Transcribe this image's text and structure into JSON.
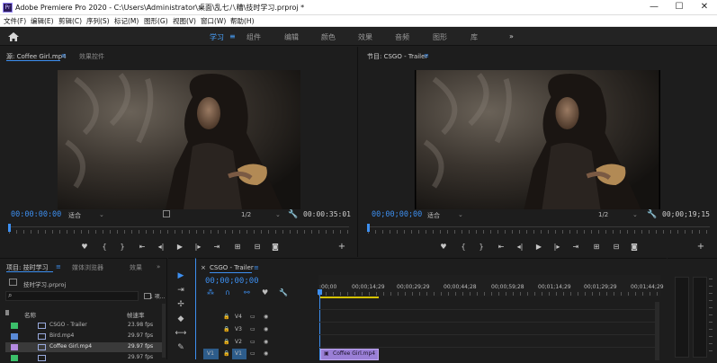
{
  "window": {
    "title": "Adobe Premiere Pro 2020 - C:\\Users\\Administrator\\桌面\\乱七八糟\\技时学习.prproj *",
    "minimize": "—",
    "maximize": "☐",
    "close": "✕"
  },
  "menu": [
    "文件(F)",
    "编辑(E)",
    "剪辑(C)",
    "序列(S)",
    "标记(M)",
    "图形(G)",
    "视图(V)",
    "窗口(W)",
    "帮助(H)"
  ],
  "workspaces": {
    "items": [
      "学习",
      "组件",
      "编辑",
      "颜色",
      "效果",
      "音频",
      "图形",
      "库"
    ],
    "active_menu": "≡",
    "more": "»"
  },
  "source_monitor": {
    "tabs": [
      "源: Coffee Girl.mp4",
      "效果控件"
    ],
    "menu_icon": "≡",
    "timecode_in": "00:00:00:00",
    "fit": "适合",
    "resolution": "1/2",
    "duration": "00:00:35:01"
  },
  "program_monitor": {
    "tab": "节目: CSGO - Trailer",
    "menu_icon": "≡",
    "timecode_in": "00;00;00;00",
    "fit": "适合",
    "resolution": "1/2",
    "duration": "00;00;19;15"
  },
  "transport": {
    "marker": "♥",
    "in": "{",
    "out": "}",
    "go_in": "⇤",
    "step_back": "◂|",
    "play": "▶",
    "step_fwd": "|▸",
    "go_out": "⇥",
    "insert": "⊞",
    "overwrite": "⊟",
    "export": "◙",
    "add": "+"
  },
  "project": {
    "tabs": [
      "项目: 技时学习",
      "媒体浏览器",
      "效果"
    ],
    "more": "»",
    "menu_icon": "≡",
    "filename": "技时学习.prproj",
    "search_icon": "⌕",
    "item_count": "1 项...",
    "columns": {
      "name": "名称",
      "fps": "帧速率"
    },
    "items": [
      {
        "name": "CSGO - Trailer",
        "fps": "23.98 fps",
        "color": "#3bbf6a",
        "type": "sequence"
      },
      {
        "name": "Bird.mp4",
        "fps": "29.97 fps",
        "color": "#5a8ad6",
        "type": "clip"
      },
      {
        "name": "Coffee Girl.mp4",
        "fps": "29.97 fps",
        "color": "#b48ae0",
        "type": "clip",
        "selected": true
      },
      {
        "name": "",
        "fps": "29.97 fps",
        "color": "#3bbf6a",
        "type": "clip"
      }
    ]
  },
  "tools": [
    "▶",
    "⇥",
    "✢",
    "◆",
    "⟷",
    "✎"
  ],
  "timeline": {
    "close": "×",
    "sequence": "CSGO - Trailer",
    "menu_icon": "≡",
    "timecode": "00;00;00;00",
    "ruler_labels": [
      ":00;00",
      "00;00;14;29",
      "00;00;29;29",
      "00;00;44;28",
      "00;00;59;28",
      "00;01;14;29",
      "00;01;29;29",
      "00;01;44;29"
    ],
    "tracks": [
      {
        "name": "V4"
      },
      {
        "name": "V3"
      },
      {
        "name": "V2"
      },
      {
        "name": "V1",
        "source": "V1"
      }
    ],
    "clip_label": "Coffee Girl.mp4"
  }
}
